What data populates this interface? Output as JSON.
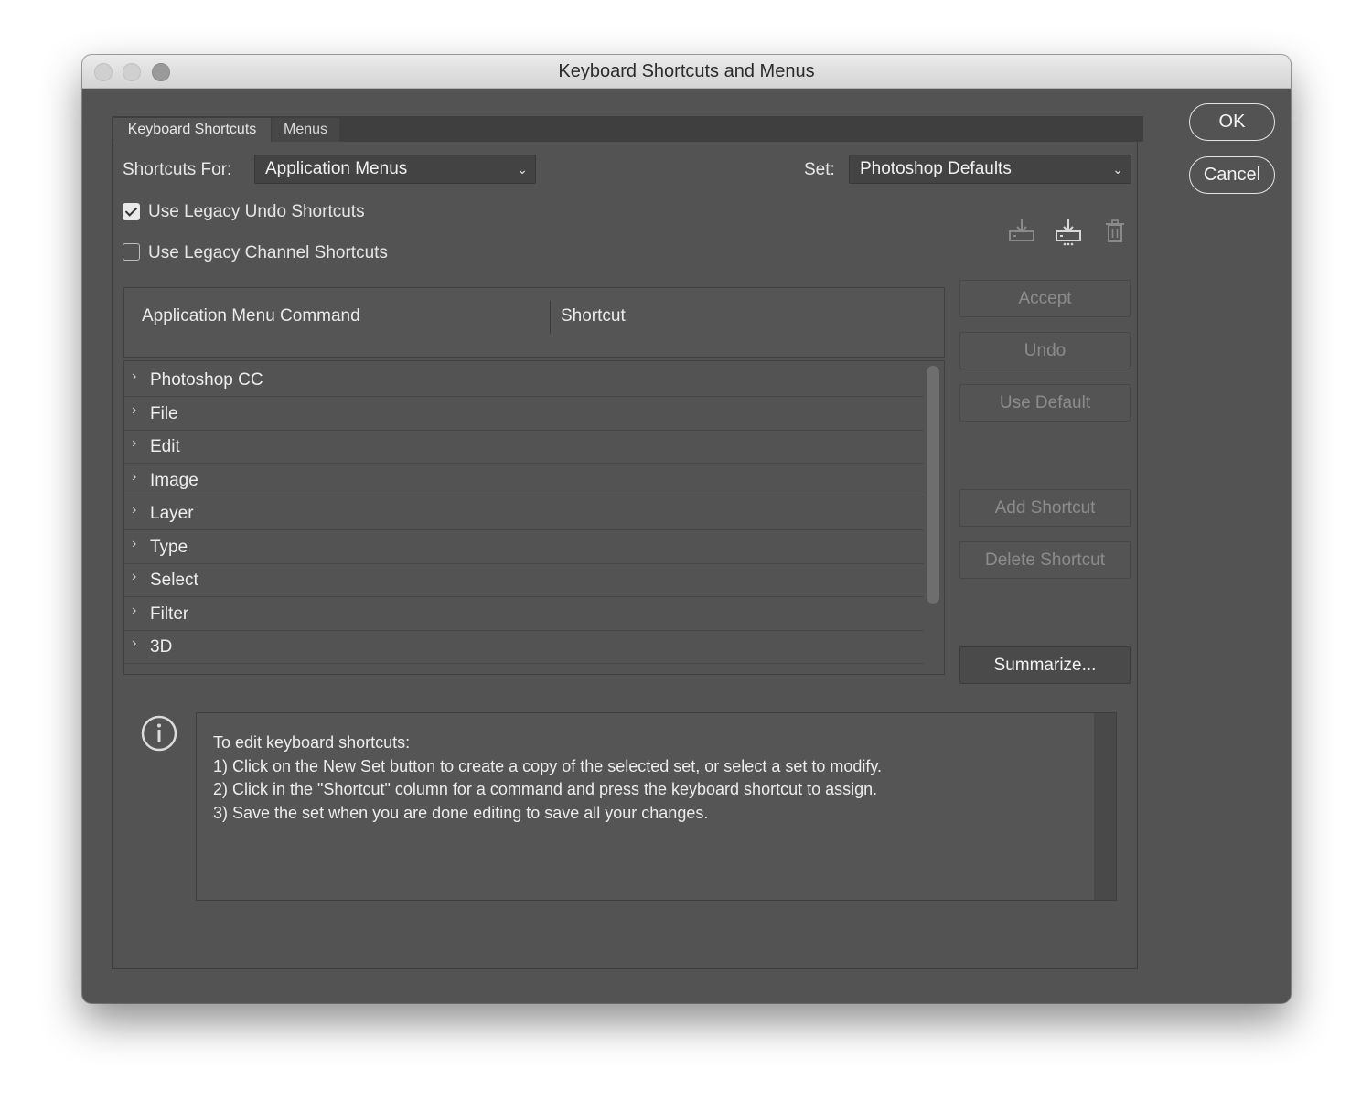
{
  "window": {
    "title": "Keyboard Shortcuts and Menus"
  },
  "tabs": [
    {
      "label": "Keyboard Shortcuts",
      "active": true
    },
    {
      "label": "Menus",
      "active": false
    }
  ],
  "shortcuts_for": {
    "label": "Shortcuts For:",
    "value": "Application Menus"
  },
  "set": {
    "label": "Set:",
    "value": "Photoshop Defaults"
  },
  "options": {
    "legacy_undo": {
      "label": "Use Legacy Undo Shortcuts",
      "checked": true
    },
    "legacy_channel": {
      "label": "Use Legacy Channel Shortcuts",
      "checked": false
    }
  },
  "set_icons": [
    "save-set-icon",
    "new-set-icon",
    "delete-set-icon"
  ],
  "table": {
    "headers": {
      "command": "Application Menu Command",
      "shortcut": "Shortcut"
    },
    "rows": [
      {
        "name": "Photoshop CC"
      },
      {
        "name": "File"
      },
      {
        "name": "Edit"
      },
      {
        "name": "Image"
      },
      {
        "name": "Layer"
      },
      {
        "name": "Type"
      },
      {
        "name": "Select"
      },
      {
        "name": "Filter"
      },
      {
        "name": "3D"
      }
    ]
  },
  "actions": {
    "accept": "Accept",
    "undo": "Undo",
    "use_default": "Use Default",
    "add_shortcut": "Add Shortcut",
    "delete_shortcut": "Delete Shortcut",
    "summarize": "Summarize..."
  },
  "dialog_buttons": {
    "ok": "OK",
    "cancel": "Cancel"
  },
  "info": {
    "lines": [
      "To edit keyboard shortcuts:",
      "1) Click on the New Set button to create a copy of the selected set, or select a set to modify.",
      "2) Click in the \"Shortcut\" column for a command and press the keyboard shortcut to assign.",
      "3) Save the set when you are done editing to save all your changes."
    ]
  },
  "colors": {
    "window_bg": "#535353",
    "titlebar": "#dcdcdc",
    "text": "#eeeeee",
    "disabled_text": "#8c8c8c"
  }
}
